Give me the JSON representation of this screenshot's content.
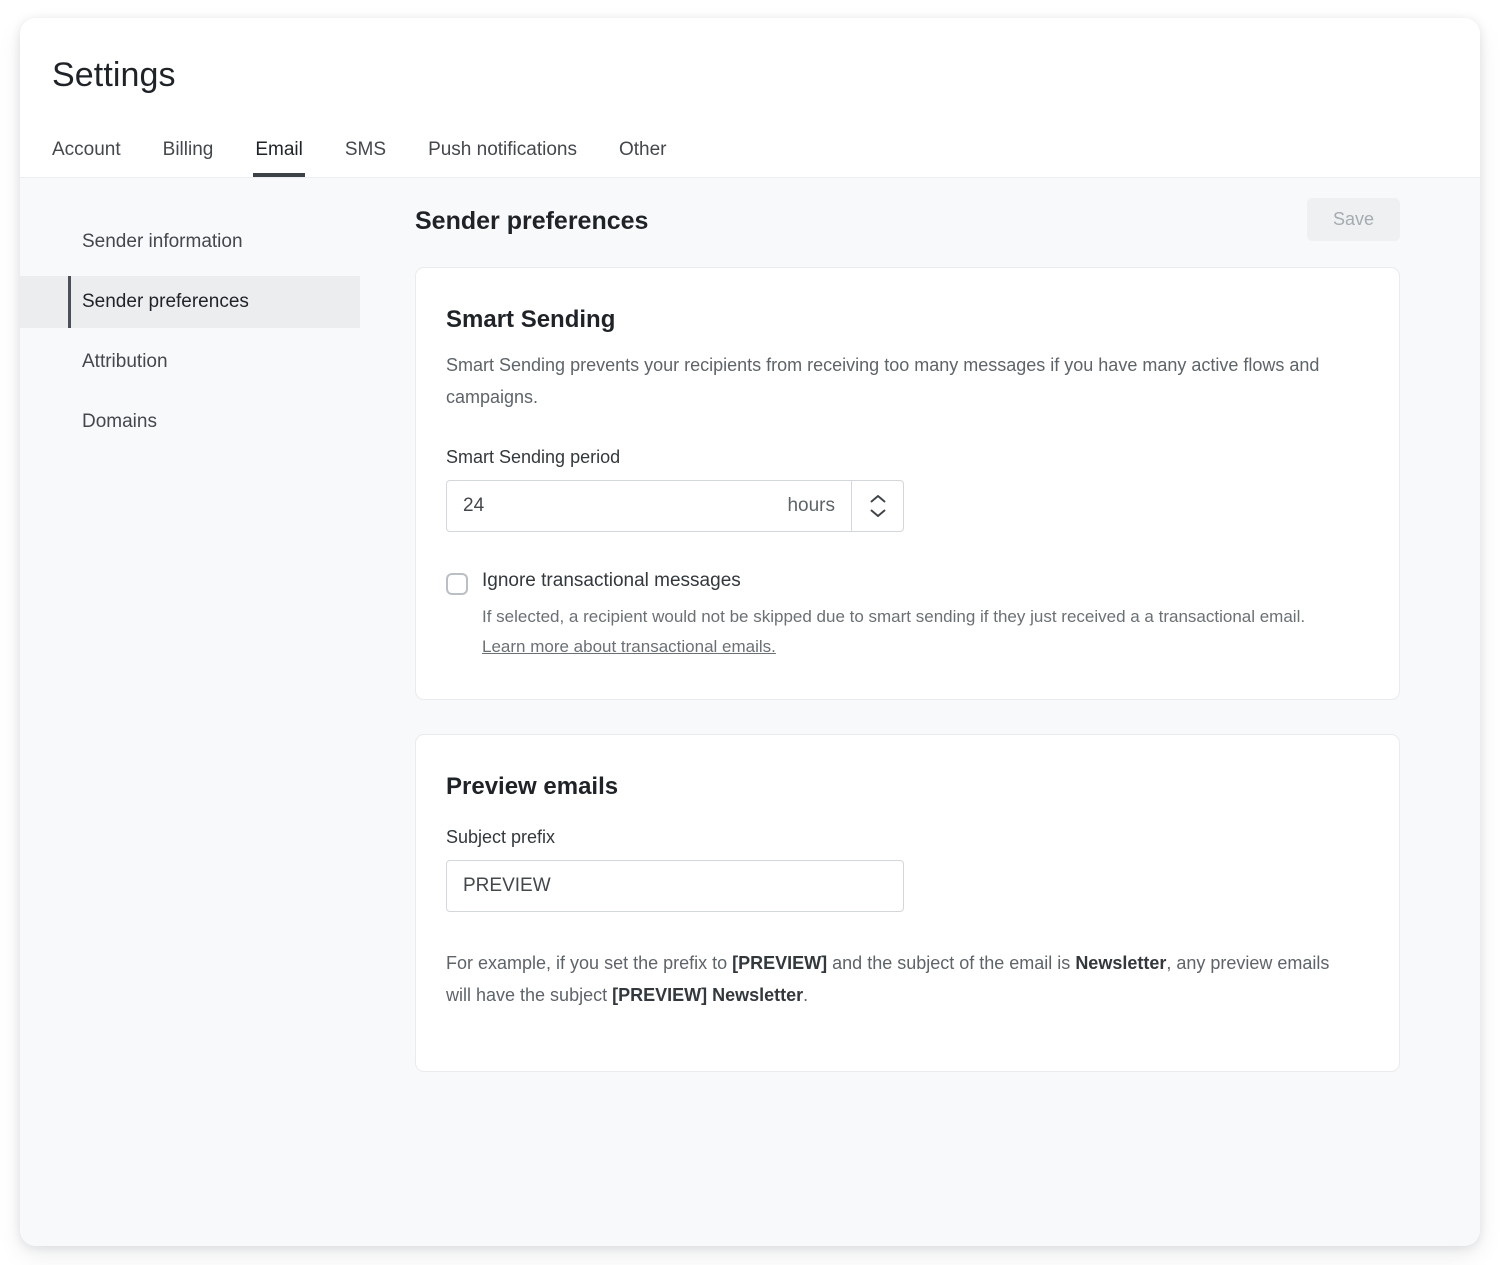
{
  "window": {
    "title": "Settings"
  },
  "tabs": [
    {
      "label": "Account",
      "active": false
    },
    {
      "label": "Billing",
      "active": false
    },
    {
      "label": "Email",
      "active": true
    },
    {
      "label": "SMS",
      "active": false
    },
    {
      "label": "Push notifications",
      "active": false
    },
    {
      "label": "Other",
      "active": false
    }
  ],
  "sidebar": {
    "items": [
      {
        "label": "Sender information",
        "active": false
      },
      {
        "label": "Sender preferences",
        "active": true
      },
      {
        "label": "Attribution",
        "active": false
      },
      {
        "label": "Domains",
        "active": false
      }
    ]
  },
  "main": {
    "title": "Sender preferences",
    "save_label": "Save",
    "save_disabled": true,
    "smart_sending": {
      "title": "Smart Sending",
      "description": "Smart Sending prevents your recipients from receiving too many messages if you have many active flows and campaigns.",
      "period_label": "Smart Sending period",
      "period_value": "24",
      "period_unit": "hours",
      "stepper_up_icon": "chevron-up-icon",
      "stepper_down_icon": "chevron-down-icon",
      "checkbox": {
        "label": "Ignore transactional messages",
        "checked": false,
        "help": "If selected, a recipient would not be skipped due to smart sending if they just received a a transactional email.",
        "link_text": "Learn more about transactional emails."
      }
    },
    "preview_emails": {
      "title": "Preview emails",
      "prefix_label": "Subject prefix",
      "prefix_value": "PREVIEW",
      "prefix_placeholder": "PREVIEW",
      "example": {
        "part1": "For example, if you set the prefix to ",
        "bold1": "[PREVIEW]",
        "part2": " and the subject of the email is ",
        "bold2": "Newsletter",
        "part3": ", any preview emails will have the subject ",
        "bold3": "[PREVIEW] Newsletter",
        "part4": "."
      }
    }
  },
  "colors": {
    "accent": "#3d4248",
    "page_bg": "#f8f9fa",
    "card_bg": "#ffffff",
    "border": "#e9ebee"
  }
}
